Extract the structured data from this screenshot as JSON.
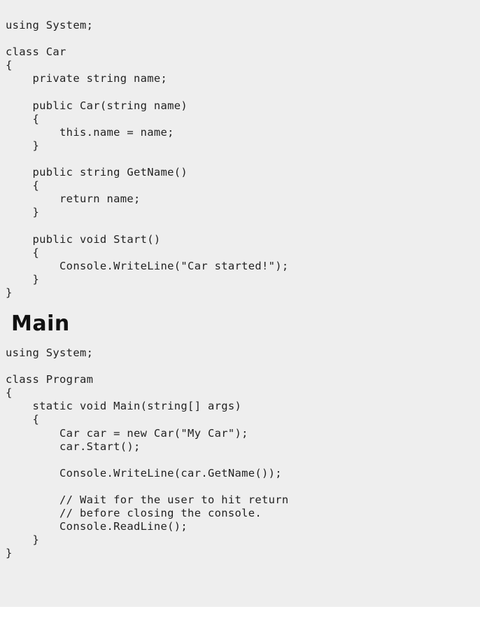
{
  "car_file": {
    "code": "using System;\n\nclass Car\n{\n    private string name;\n\n    public Car(string name)\n    {\n        this.name = name;\n    }\n\n    public string GetName()\n    {\n        return name;\n    }\n\n    public void Start()\n    {\n        Console.WriteLine(\"Car started!\");\n    }\n}"
  },
  "main_section": {
    "heading": "Main",
    "code": "using System;\n\nclass Program\n{\n    static void Main(string[] args)\n    {\n        Car car = new Car(\"My Car\");\n        car.Start();\n\n        Console.WriteLine(car.GetName());\n\n        // Wait for the user to hit return\n        // before closing the console.\n        Console.ReadLine();\n    }\n}"
  }
}
